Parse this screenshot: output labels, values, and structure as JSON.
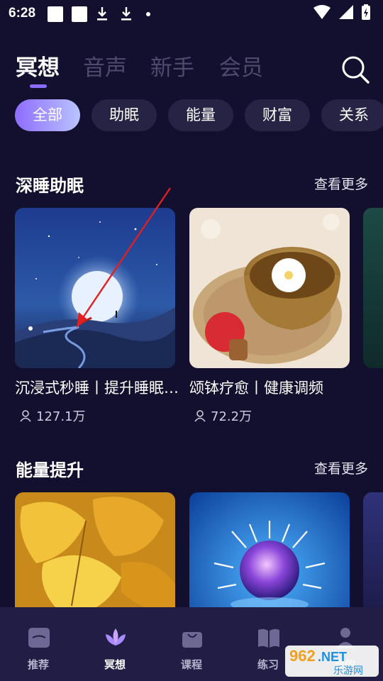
{
  "status_bar": {
    "time": "6:28"
  },
  "top_tabs": [
    {
      "label": "冥想",
      "active": true
    },
    {
      "label": "音声",
      "active": false
    },
    {
      "label": "新手",
      "active": false
    },
    {
      "label": "会员",
      "active": false
    }
  ],
  "chips": [
    {
      "label": "全部",
      "active": true
    },
    {
      "label": "助眠",
      "active": false
    },
    {
      "label": "能量",
      "active": false
    },
    {
      "label": "财富",
      "active": false
    },
    {
      "label": "关系",
      "active": false
    }
  ],
  "sections": [
    {
      "title": "深睡助眠",
      "more": "查看更多",
      "cards": [
        {
          "title": "沉浸式秒睡丨提升睡眠质量",
          "count": "127.1万"
        },
        {
          "title": "颂钵疗愈丨健康调频",
          "count": "72.2万"
        }
      ]
    },
    {
      "title": "能量提升",
      "more": "查看更多"
    }
  ],
  "bottom_nav": [
    {
      "label": "推荐",
      "icon": "more-box-icon",
      "active": false
    },
    {
      "label": "冥想",
      "icon": "lotus-icon",
      "active": true
    },
    {
      "label": "课程",
      "icon": "bag-icon",
      "active": false
    },
    {
      "label": "练习",
      "icon": "book-icon",
      "active": false
    },
    {
      "label": "我的",
      "icon": "person-icon",
      "active": false
    }
  ],
  "watermark": {
    "top_text": "962",
    "top_suffix": ".NET",
    "bottom_text": "乐游网"
  },
  "colors": {
    "background": "#130f2e",
    "accent": "#8b6cff",
    "chip": "#272345",
    "nav": "#221d44"
  }
}
